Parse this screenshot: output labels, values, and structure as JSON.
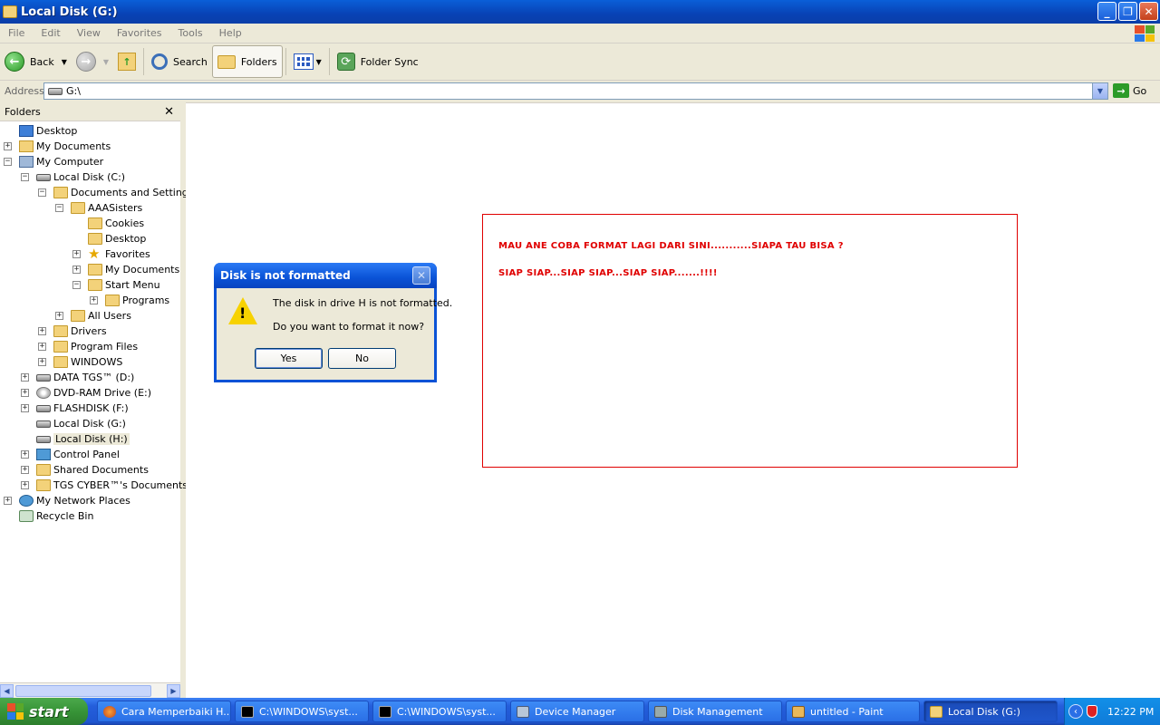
{
  "window": {
    "title": "Local Disk (G:)",
    "min_glyph": "_",
    "max_glyph": "❐",
    "close_glyph": "✕"
  },
  "menu": [
    "File",
    "Edit",
    "View",
    "Favorites",
    "Tools",
    "Help"
  ],
  "toolbar": {
    "back_label": "Back",
    "search_label": "Search",
    "folders_label": "Folders",
    "foldersync_label": "Folder Sync"
  },
  "address": {
    "label": "Address",
    "value": "G:\\",
    "go_label": "Go"
  },
  "folders_pane": {
    "title": "Folders",
    "close_glyph": "✕",
    "tree": [
      {
        "label": "Desktop",
        "depth": 0,
        "expander": "",
        "icon": "desktop"
      },
      {
        "label": "My Documents",
        "depth": 0,
        "expander": "+",
        "icon": "docs"
      },
      {
        "label": "My Computer",
        "depth": 0,
        "expander": "−",
        "icon": "computer"
      },
      {
        "label": "Local Disk (C:)",
        "depth": 1,
        "expander": "−",
        "icon": "drive"
      },
      {
        "label": "Documents and Settings",
        "depth": 2,
        "expander": "−",
        "icon": "folder"
      },
      {
        "label": "AAASisters",
        "depth": 3,
        "expander": "−",
        "icon": "folder"
      },
      {
        "label": "Cookies",
        "depth": 4,
        "expander": "",
        "icon": "folder"
      },
      {
        "label": "Desktop",
        "depth": 4,
        "expander": "",
        "icon": "folder"
      },
      {
        "label": "Favorites",
        "depth": 4,
        "expander": "+",
        "icon": "star"
      },
      {
        "label": "My Documents",
        "depth": 4,
        "expander": "+",
        "icon": "folder"
      },
      {
        "label": "Start Menu",
        "depth": 4,
        "expander": "−",
        "icon": "folder"
      },
      {
        "label": "Programs",
        "depth": 5,
        "expander": "+",
        "icon": "folder"
      },
      {
        "label": "All Users",
        "depth": 3,
        "expander": "+",
        "icon": "folder"
      },
      {
        "label": "Drivers",
        "depth": 2,
        "expander": "+",
        "icon": "folder"
      },
      {
        "label": "Program Files",
        "depth": 2,
        "expander": "+",
        "icon": "folder"
      },
      {
        "label": "WINDOWS",
        "depth": 2,
        "expander": "+",
        "icon": "folder"
      },
      {
        "label": "DATA TGS™ (D:)",
        "depth": 1,
        "expander": "+",
        "icon": "drive"
      },
      {
        "label": "DVD-RAM Drive (E:)",
        "depth": 1,
        "expander": "+",
        "icon": "cdrom"
      },
      {
        "label": "FLASHDISK (F:)",
        "depth": 1,
        "expander": "+",
        "icon": "drive"
      },
      {
        "label": "Local Disk (G:)",
        "depth": 1,
        "expander": "",
        "icon": "drive"
      },
      {
        "label": "Local Disk (H:)",
        "depth": 1,
        "expander": "",
        "icon": "drive",
        "selected": true
      },
      {
        "label": "Control Panel",
        "depth": 1,
        "expander": "+",
        "icon": "cpanel"
      },
      {
        "label": "Shared Documents",
        "depth": 1,
        "expander": "+",
        "icon": "folder"
      },
      {
        "label": "TGS CYBER™'s Documents",
        "depth": 1,
        "expander": "+",
        "icon": "folder"
      },
      {
        "label": "My Network Places",
        "depth": 0,
        "expander": "+",
        "icon": "network"
      },
      {
        "label": "Recycle Bin",
        "depth": 0,
        "expander": "",
        "icon": "recycle"
      }
    ]
  },
  "note": {
    "line1": "MAU ANE COBA FORMAT LAGI DARI SINI...........SIAPA TAU BISA ?",
    "line2": "SIAP SIAP...SIAP SIAP...SIAP SIAP.......!!!!"
  },
  "dialog": {
    "title": "Disk is not formatted",
    "message": "The disk in drive H is not formatted.",
    "question": "Do you want to format it now?",
    "yes_label": "Yes",
    "no_label": "No",
    "close_glyph": "✕"
  },
  "taskbar": {
    "start_label": "start",
    "tasks": [
      {
        "label": "Cara Memperbaiki H...",
        "icon": "ff"
      },
      {
        "label": "C:\\WINDOWS\\syst...",
        "icon": "cmd"
      },
      {
        "label": "C:\\WINDOWS\\syst...",
        "icon": "cmd"
      },
      {
        "label": "Device Manager",
        "icon": "dev"
      },
      {
        "label": "Disk Management",
        "icon": "disk"
      },
      {
        "label": "untitled - Paint",
        "icon": "paint"
      },
      {
        "label": "Local Disk (G:)",
        "icon": "fold",
        "active": true
      }
    ],
    "clock": "12:22 PM"
  },
  "colors": {
    "note_red": "#e00000",
    "xp_blue": "#0a52d6",
    "start_green": "#379437"
  }
}
